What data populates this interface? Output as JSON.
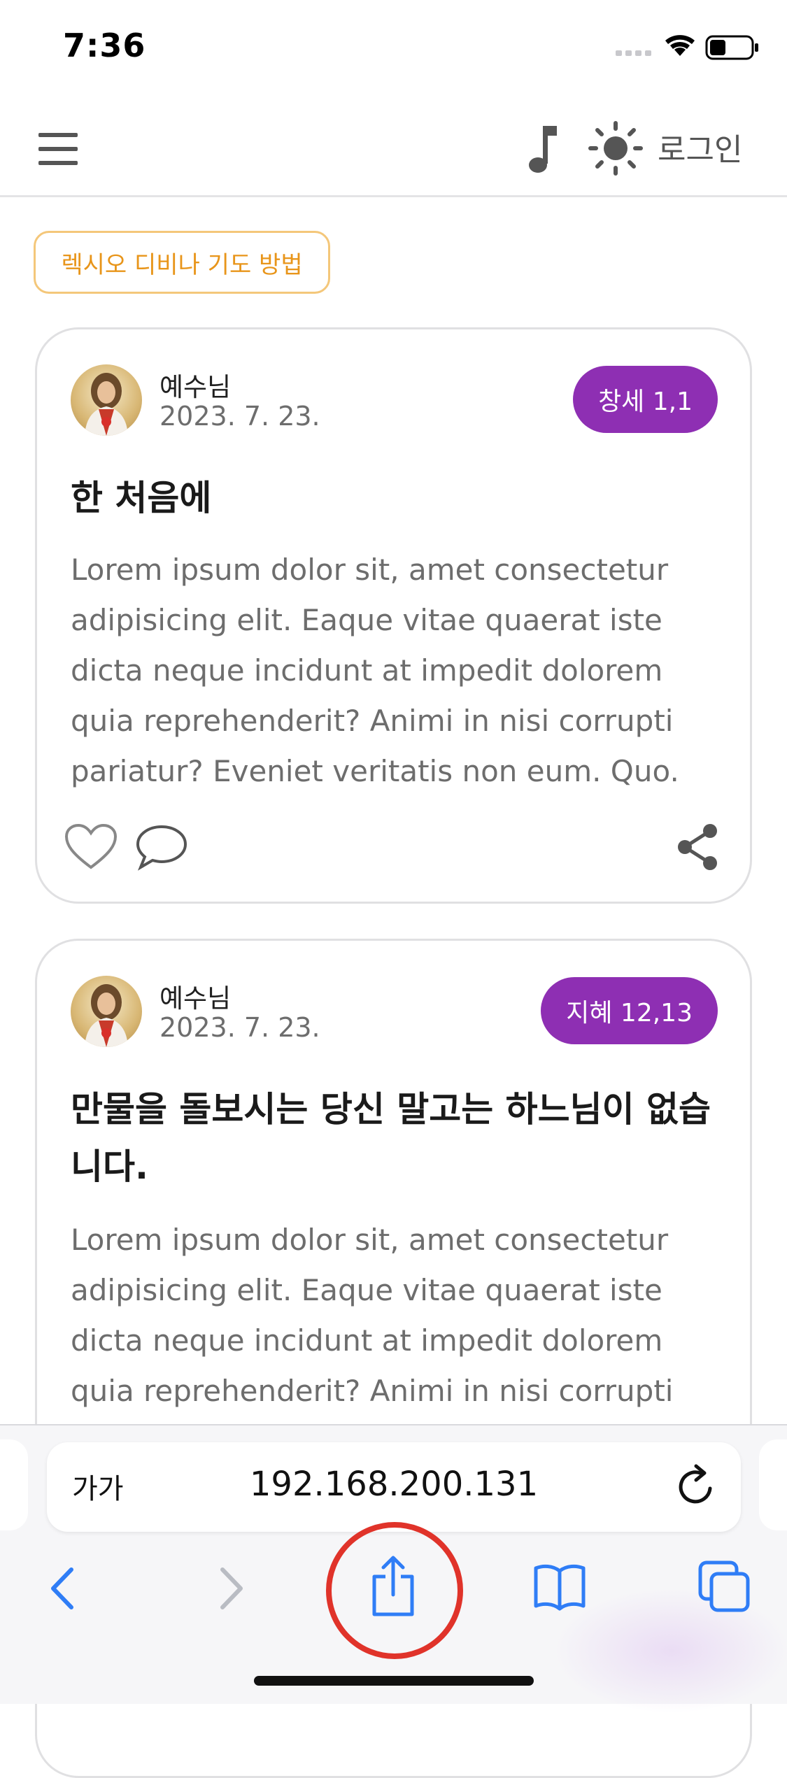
{
  "status_bar": {
    "time": "7:36"
  },
  "header": {
    "login_label": "로그인"
  },
  "tag": {
    "label": "렉시오 디비나 기도 방법"
  },
  "posts": [
    {
      "author": "예수님",
      "date": "2023. 7. 23.",
      "reference": "창세 1,1",
      "title": "한 처음에",
      "body": "Lorem ipsum dolor sit, amet consectetur adipisicing elit. Eaque vitae quaerat iste dicta neque incidunt at impedit dolorem quia reprehenderit? Animi in nisi corrupti pariatur? Eveniet veritatis non eum. Quo."
    },
    {
      "author": "예수님",
      "date": "2023. 7. 23.",
      "reference": "지혜 12,13",
      "title": "만물을 돌보시는 당신 말고는 하느님이 없습니다.",
      "body": "Lorem ipsum dolor sit, amet consectetur adipisicing elit. Eaque vitae quaerat iste dicta neque incidunt at impedit dolorem quia reprehenderit? Animi in nisi corrupti pariatur? Eveniet veritatis non eum. Quo."
    }
  ],
  "browser": {
    "text_size_label": "가가",
    "url": "192.168.200.131"
  },
  "colors": {
    "accent_purple": "#8e2fb3",
    "tag_orange": "#e8951a",
    "ios_blue": "#2f7df6",
    "highlight_red": "#e0332a"
  },
  "icons": [
    "menu-icon",
    "music-note-icon",
    "sun-icon",
    "heart-icon",
    "comment-icon",
    "share-icon",
    "reload-icon",
    "back-icon",
    "forward-icon",
    "share-upload-icon",
    "bookmarks-icon",
    "tabs-icon"
  ]
}
